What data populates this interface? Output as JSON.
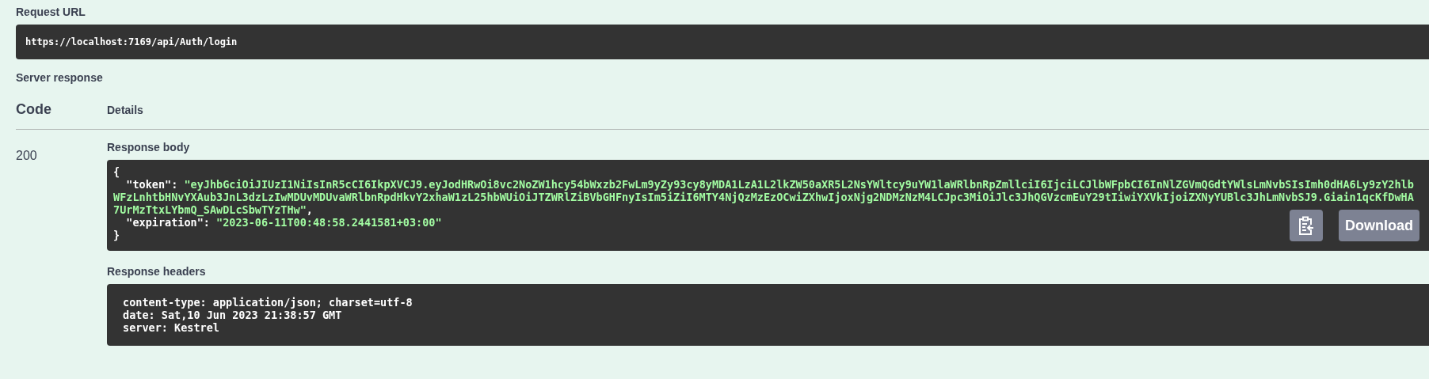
{
  "request_url": {
    "label": "Request URL",
    "value": "https://localhost:7169/api/Auth/login"
  },
  "server_response": {
    "label": "Server response",
    "columns": [
      "Code",
      "Details"
    ],
    "responses": [
      {
        "code": "200",
        "body": {
          "label": "Response body",
          "lines": [
            {
              "kind": "plain",
              "text": "{"
            },
            {
              "kind": "field",
              "key": "  \"token\": ",
              "value": "\"eyJhbGciOiJIUzI1NiIsInR5cCI6IkpXVCJ9.eyJodHRwOi8vc2NoZW1hcy54bWxzb2FwLm9yZy93cy8yMDA1LzA1L2lkZW50aXR5L2NsYWltcy9uYW1laWRlbnRpZmllciI6IjciLCJlbWFpbCI6InNlZGVmQGdtYWlsLmNvbSIsImh0dHA6Ly9zY2hlbWFzLnhtbHNvYXAub3JnL3dzLzIwMDUvMDUvaWRlbnRpdHkvY2xhaW1zL25hbWUiOiJTZWRlZiBVbGHFnyIsIm5iZiI6MTY4NjQzMzEzOCwiZXhwIjoxNjg2NDMzNzM4LCJpc3MiOiJlc3JhQGVzcmEuY29tIiwiYXVkIjoiZXNyYUBlc3JhLmNvbSJ9.Giain1qcKfDwHA7UrMzTtxLYbmQ_SAwDLcSbwTYzTHw\"",
              "end": ","
            },
            {
              "kind": "field",
              "key": "  \"expiration\": ",
              "value": "\"2023-06-11T00:48:58.2441581+03:00\""
            },
            {
              "kind": "plain",
              "text": "}"
            }
          ],
          "download": "Download"
        },
        "headers": {
          "label": "Response headers",
          "lines": [
            "content-type: application/json; charset=utf-8",
            "date: Sat,10 Jun 2023 21:38:57 GMT",
            "server: Kestrel"
          ]
        }
      }
    ]
  }
}
